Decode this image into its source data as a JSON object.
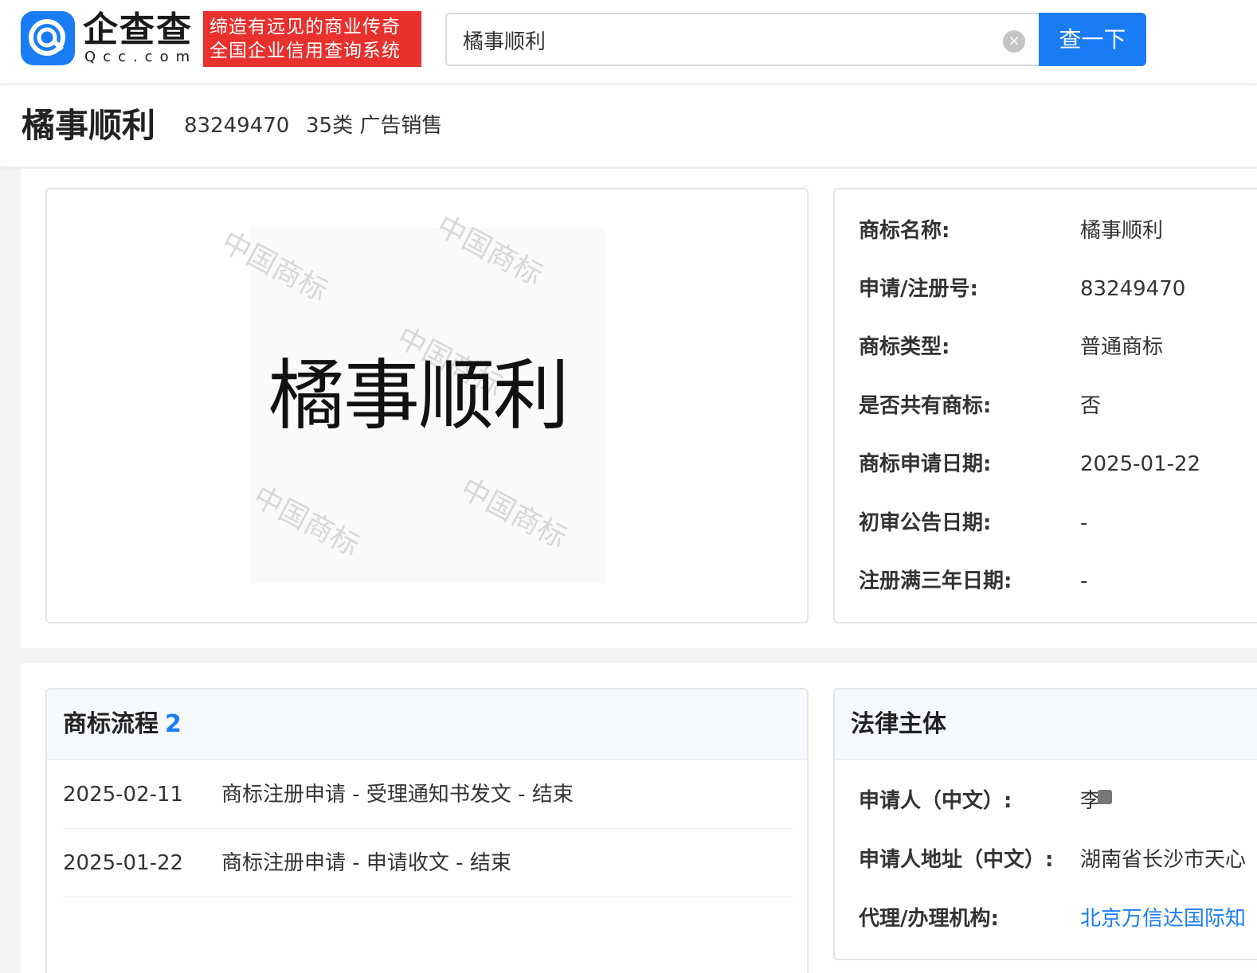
{
  "header": {
    "logo_cn": "企查查",
    "logo_en": "Qcc.com",
    "slogan_line1": "缔造有远见的商业传奇",
    "slogan_line2": "全国企业信用查询系统",
    "search_value": "橘事顺利",
    "search_button": "查一下"
  },
  "title": {
    "name": "橘事顺利",
    "reg_no": "83249470",
    "class": "35类 广告销售"
  },
  "image": {
    "trademark_text": "橘事顺利",
    "watermark": "中国商标"
  },
  "info": {
    "rows": [
      {
        "label": "商标名称:",
        "value": "橘事顺利"
      },
      {
        "label": "申请/注册号:",
        "value": "83249470"
      },
      {
        "label": "商标类型:",
        "value": "普通商标"
      },
      {
        "label": "是否共有商标:",
        "value": "否"
      },
      {
        "label": "商标申请日期:",
        "value": "2025-01-22"
      },
      {
        "label": "初审公告日期:",
        "value": "-"
      },
      {
        "label": "注册满三年日期:",
        "value": "-"
      }
    ]
  },
  "flow": {
    "title": "商标流程",
    "count": "2",
    "rows": [
      {
        "date": "2025-02-11",
        "desc": "商标注册申请 - 受理通知书发文 - 结束"
      },
      {
        "date": "2025-01-22",
        "desc": "商标注册申请 - 申请收文 - 结束"
      }
    ]
  },
  "legal": {
    "title": "法律主体",
    "rows": [
      {
        "label": "申请人（中文）:",
        "value": "李"
      },
      {
        "label": "申请人地址（中文）:",
        "value": "湖南省长沙市天心"
      },
      {
        "label": "代理/办理机构:",
        "value": "北京万信达国际知"
      }
    ]
  },
  "colors": {
    "accent": "#1a7cf5",
    "slogan_bg": "#e8302c"
  }
}
